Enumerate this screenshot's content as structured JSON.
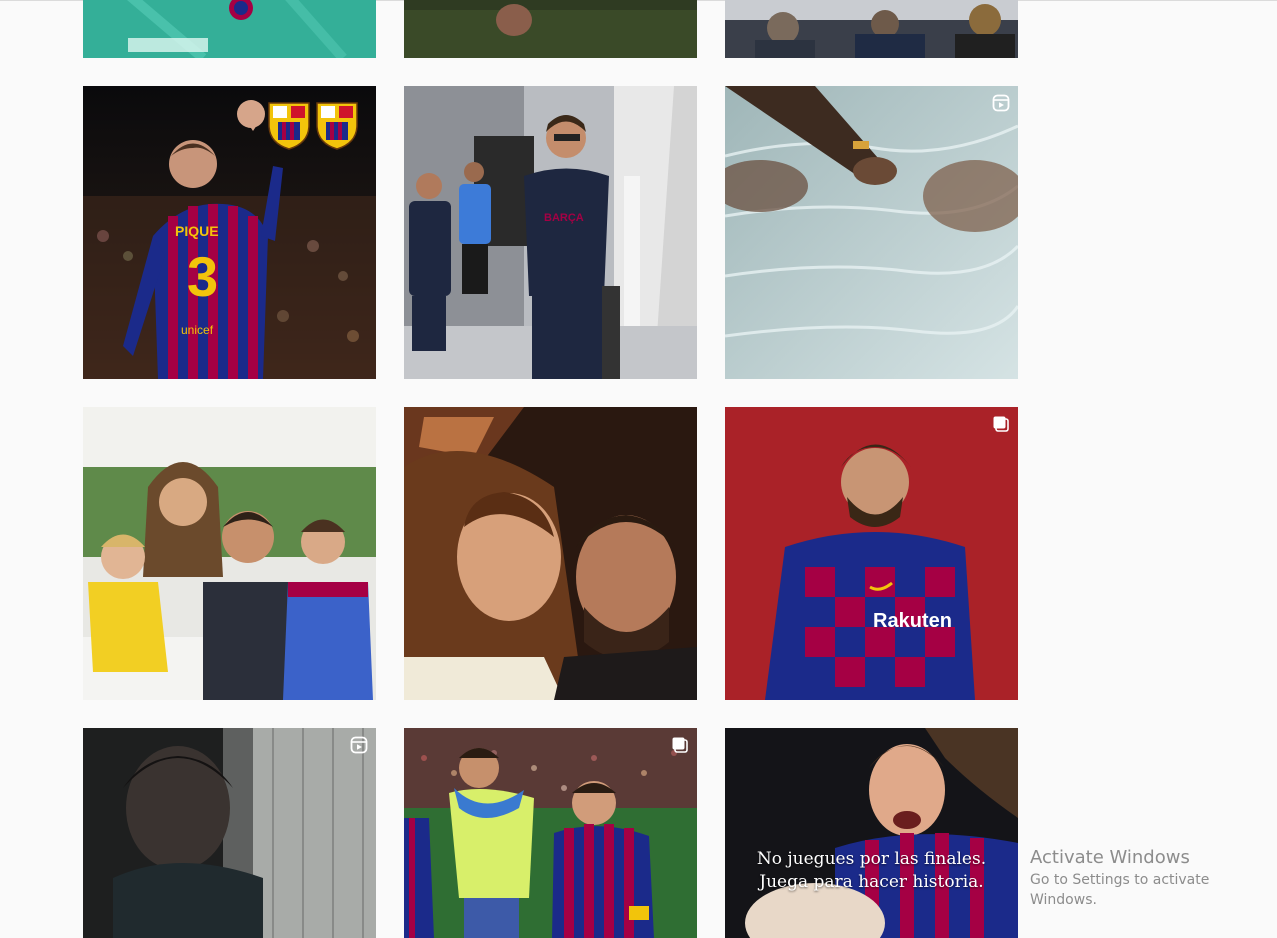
{
  "feed": {
    "rows": [
      {
        "posts": [
          {
            "label": "Post: player in teal kit",
            "badge": "none"
          },
          {
            "label": "Post: ball on grass",
            "badge": "none"
          },
          {
            "label": "Post: people seated at event",
            "badge": "none"
          }
        ]
      },
      {
        "posts": [
          {
            "label": "Post: Pique #3 waving with FCB crests",
            "badge": "none"
          },
          {
            "label": "Post: team arriving at airport",
            "badge": "none"
          },
          {
            "label": "Post: hand over water",
            "badge": "reel"
          }
        ]
      },
      {
        "posts": [
          {
            "label": "Post: family on golf cart",
            "badge": "none"
          },
          {
            "label": "Post: couple selfie",
            "badge": "none"
          },
          {
            "label": "Post: player portrait red background",
            "badge": "carousel"
          }
        ]
      },
      {
        "posts": [
          {
            "label": "Post: man in dark corridor",
            "badge": "reel"
          },
          {
            "label": "Post: players celebrating in stadium",
            "badge": "carousel"
          },
          {
            "label": "Post: player with campaign text",
            "badge": "none",
            "caption_line1": "No juegues por las finales.",
            "caption_line2": "Juega para hacer historia."
          }
        ]
      }
    ],
    "shirt_name": "PIQUE",
    "shirt_number": "3",
    "shirt_sponsor": "unicef"
  },
  "os_watermark": {
    "title": "Activate Windows",
    "subtitle": "Go to Settings to activate Windows."
  },
  "colors": {
    "background": "#fafafa",
    "barca_blue": "#1b2a8a",
    "barca_red": "#a50044",
    "badge_white": "#ffffff"
  },
  "icons": {
    "reel": "reel-icon",
    "carousel": "carousel-icon"
  }
}
